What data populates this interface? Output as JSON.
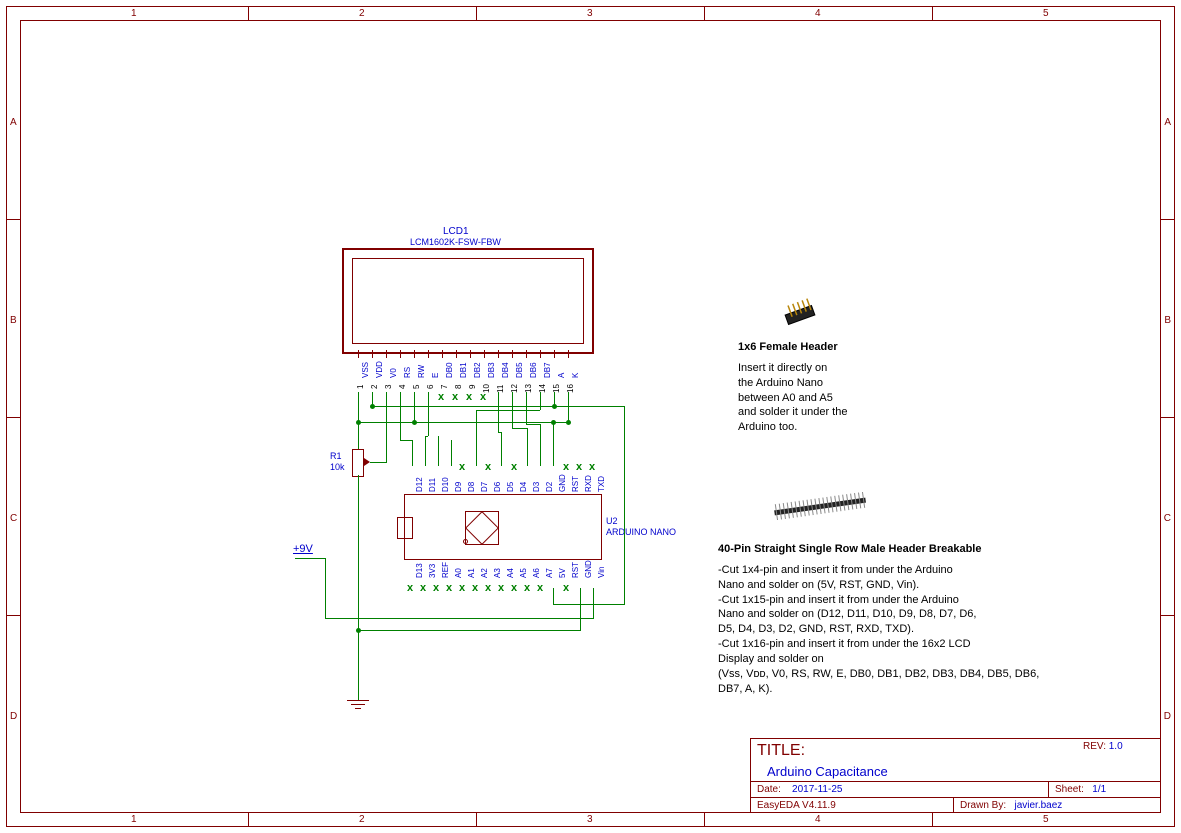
{
  "frame": {
    "columns": [
      "1",
      "2",
      "3",
      "4",
      "5"
    ],
    "rows": [
      "A",
      "B",
      "C",
      "D"
    ]
  },
  "lcd": {
    "ref": "LCD1",
    "part": "LCM1602K-FSW-FBW",
    "pins": [
      "VSS",
      "VDD",
      "V0",
      "RS",
      "RW",
      "E",
      "DB0",
      "DB1",
      "DB2",
      "DB3",
      "DB4",
      "DB5",
      "DB6",
      "DB7",
      "A",
      "K"
    ],
    "nums": [
      "1",
      "2",
      "3",
      "4",
      "5",
      "6",
      "7",
      "8",
      "9",
      "10",
      "11",
      "12",
      "13",
      "14",
      "15",
      "16"
    ]
  },
  "pot": {
    "ref": "R1",
    "val": "10k"
  },
  "supply": "+9V",
  "nano": {
    "ref": "U2",
    "part": "ARDUINO NANO",
    "top_pins": [
      "D12",
      "D11",
      "D10",
      "D9",
      "D8",
      "D7",
      "D6",
      "D5",
      "D4",
      "D3",
      "D2",
      "GND",
      "RST",
      "RXD",
      "TXD"
    ],
    "bot_pins": [
      "D13",
      "3V3",
      "REF",
      "A0",
      "A1",
      "A2",
      "A3",
      "A4",
      "A5",
      "A6",
      "A7",
      "5V",
      "RST",
      "GND",
      "Vin"
    ]
  },
  "notes1": {
    "heading": "1x6 Female Header",
    "lines": [
      "Insert it directly on",
      "the Arduino Nano",
      "between A0 and A5",
      "and solder it under the",
      "Arduino too."
    ]
  },
  "notes2": {
    "heading": "40-Pin Straight Single Row Male Header Breakable",
    "lines": [
      "-Cut 1x4-pin and insert it from under the Arduino",
      "Nano and solder on (5V, RST, GND, Vin).",
      "-Cut 1x15-pin and insert it from under the Arduino",
      "Nano and solder on (D12, D11, D10, D9, D8, D7, D6,",
      "D5, D4, D3, D2, GND, RST, RXD, TXD).",
      "-Cut 1x16-pin and insert it from under the 16x2 LCD",
      "Display and solder on",
      "(Vss, Vᴅᴅ, V0, RS, RW, E, DB0, DB1, DB2, DB3, DB4, DB5, DB6,",
      "DB7, A, K)."
    ]
  },
  "titleblock": {
    "title_label": "TITLE:",
    "title": "Arduino Capacitance",
    "rev_label": "REV:",
    "rev": "1.0",
    "date_label": "Date:",
    "date": "2017-11-25",
    "sheet_label": "Sheet:",
    "sheet": "1/1",
    "tool": "EasyEDA V4.11.9",
    "drawnby_label": "Drawn By:",
    "drawnby": "javier.baez"
  }
}
